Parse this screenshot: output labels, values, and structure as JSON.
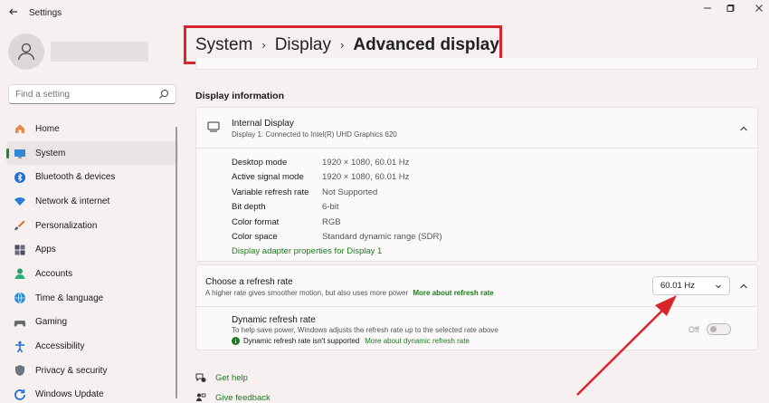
{
  "window": {
    "title": "Settings",
    "back_icon": "back-arrow-icon",
    "controls": [
      "minimize-icon",
      "maximize-icon",
      "close-icon"
    ]
  },
  "sidebar": {
    "search": {
      "placeholder": "Find a setting",
      "icon": "search-icon"
    },
    "items": [
      {
        "label": "Home",
        "icon": "home-icon",
        "active": false
      },
      {
        "label": "System",
        "icon": "system-icon",
        "active": true
      },
      {
        "label": "Bluetooth & devices",
        "icon": "bluetooth-icon",
        "active": false
      },
      {
        "label": "Network & internet",
        "icon": "wifi-icon",
        "active": false
      },
      {
        "label": "Personalization",
        "icon": "brush-icon",
        "active": false
      },
      {
        "label": "Apps",
        "icon": "apps-icon",
        "active": false
      },
      {
        "label": "Accounts",
        "icon": "account-icon",
        "active": false
      },
      {
        "label": "Time & language",
        "icon": "globe-icon",
        "active": false
      },
      {
        "label": "Gaming",
        "icon": "gamepad-icon",
        "active": false
      },
      {
        "label": "Accessibility",
        "icon": "accessibility-icon",
        "active": false
      },
      {
        "label": "Privacy & security",
        "icon": "shield-icon",
        "active": false
      },
      {
        "label": "Windows Update",
        "icon": "update-icon",
        "active": false
      }
    ]
  },
  "breadcrumb": {
    "items": [
      "System",
      "Display"
    ],
    "current": "Advanced display",
    "separator": "›"
  },
  "display_info": {
    "section_title": "Display information",
    "name": "Internal Display",
    "subtitle": "Display 1: Connected to Intel(R) UHD Graphics 620",
    "specs": [
      {
        "label": "Desktop mode",
        "value": "1920 × 1080, 60.01 Hz"
      },
      {
        "label": "Active signal mode",
        "value": "1920 × 1080, 60.01 Hz"
      },
      {
        "label": "Variable refresh rate",
        "value": "Not Supported"
      },
      {
        "label": "Bit depth",
        "value": "6-bit"
      },
      {
        "label": "Color format",
        "value": "RGB"
      },
      {
        "label": "Color space",
        "value": "Standard dynamic range (SDR)"
      }
    ],
    "adapter_link": "Display adapter properties for Display 1"
  },
  "refresh": {
    "title": "Choose a refresh rate",
    "subtitle": "A higher rate gives smoother motion, but also uses more power",
    "more_link": "More about refresh rate",
    "selected_rate": "60.01 Hz",
    "dynamic": {
      "title": "Dynamic refresh rate",
      "subtitle": "To help save power, Windows adjusts the refresh rate up to the selected rate above",
      "warning": "Dynamic refresh rate isn't supported",
      "more_link": "More about dynamic refresh rate",
      "toggle_label": "Off",
      "toggle_on": false
    }
  },
  "footer": {
    "help": "Get help",
    "feedback": "Give feedback"
  },
  "colors": {
    "accent": "#1b8a2a",
    "link": "#1e7a1e",
    "highlight_box": "#d9262c",
    "arrow": "#d9262c",
    "background": "#f6f0f1"
  }
}
